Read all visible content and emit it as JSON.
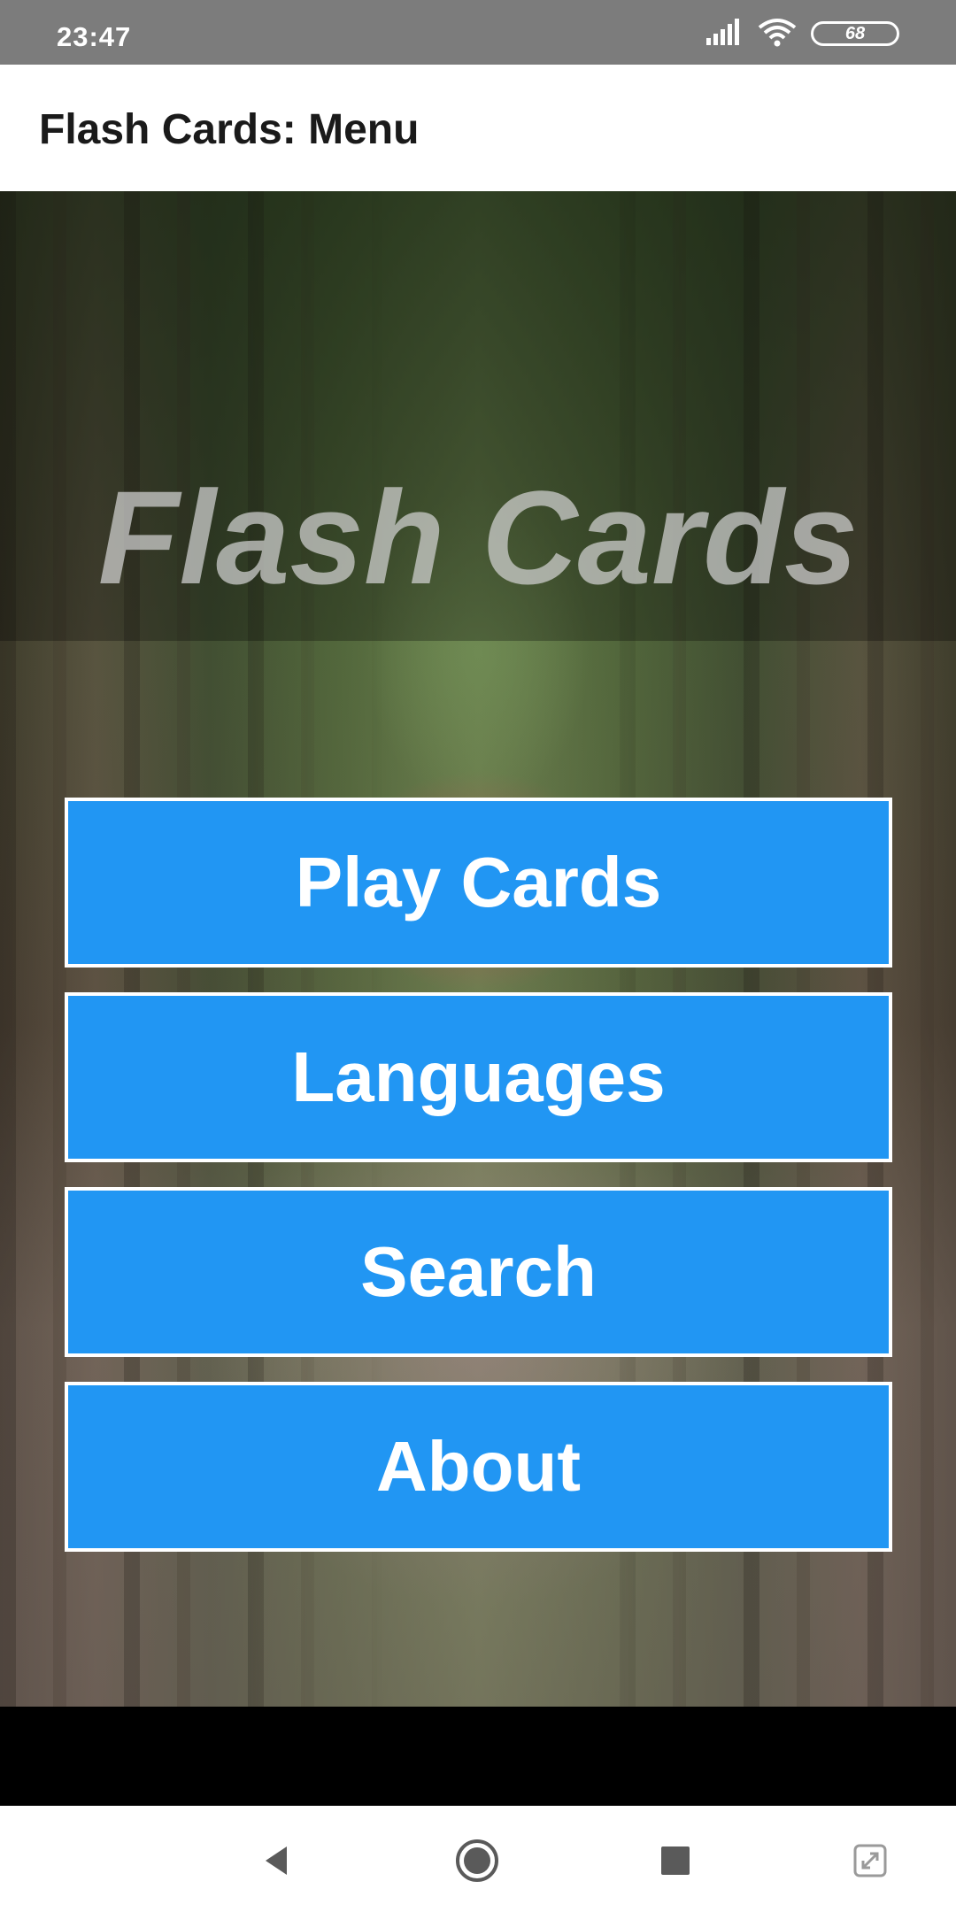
{
  "status_bar": {
    "time": "23:47",
    "battery": "68",
    "icons": [
      "signal-icon",
      "wifi-icon",
      "battery-icon"
    ]
  },
  "app_bar": {
    "title": "Flash Cards: Menu"
  },
  "hero": {
    "title": "Flash Cards"
  },
  "menu": {
    "buttons": [
      {
        "label": "Play Cards"
      },
      {
        "label": "Languages"
      },
      {
        "label": "Search"
      },
      {
        "label": "About"
      }
    ]
  },
  "nav_bar": {
    "icons": [
      "back-icon",
      "home-icon",
      "recents-icon",
      "screen-expand-icon"
    ]
  },
  "colors": {
    "accent": "#2196F3",
    "status_bar": "#7C7C7C",
    "app_bar": "#FFFFFF"
  }
}
